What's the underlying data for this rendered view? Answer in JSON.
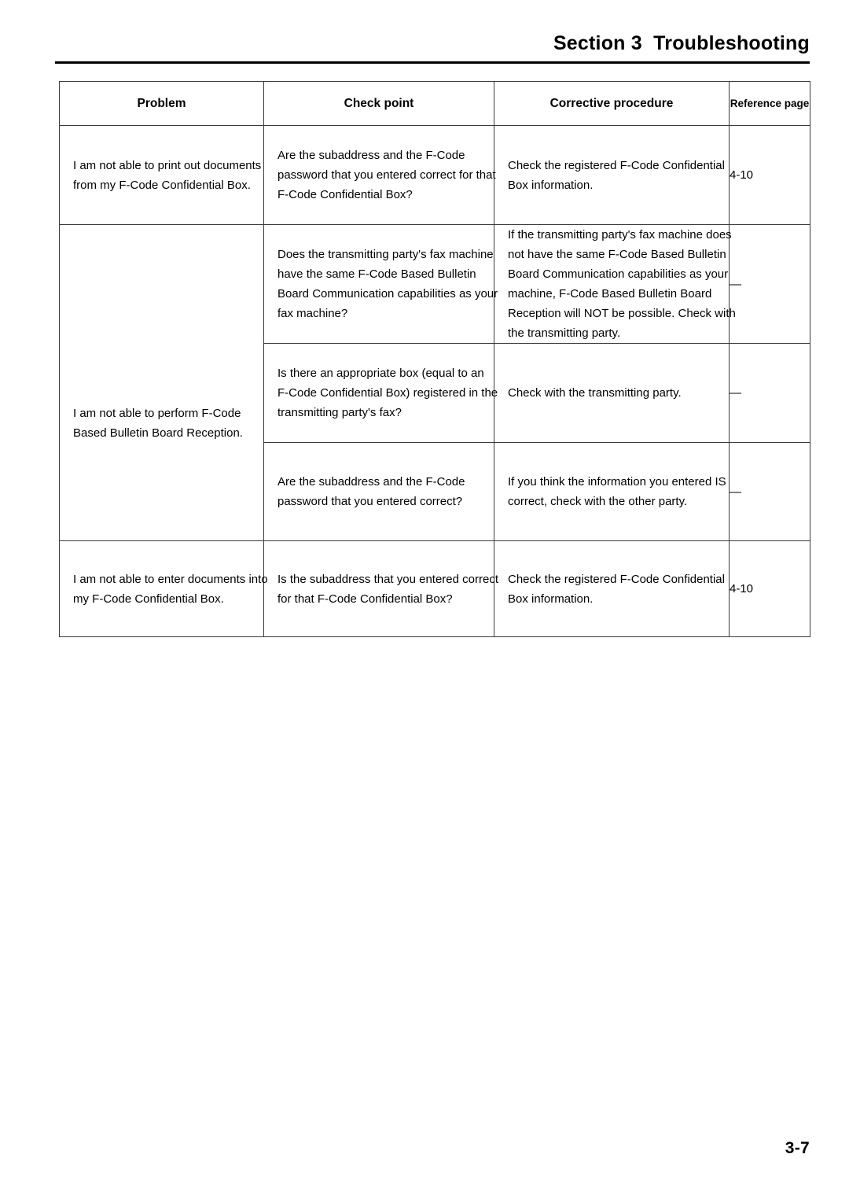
{
  "header": {
    "section_title": "Section 3  Troubleshooting"
  },
  "table": {
    "columns": [
      {
        "id": "problem",
        "label": "Problem"
      },
      {
        "id": "check_point",
        "label": "Check point"
      },
      {
        "id": "corrective_procedure",
        "label": "Corrective procedure"
      },
      {
        "id": "reference_page",
        "label": "Reference page"
      }
    ],
    "rows": [
      {
        "problem": [
          "I am not able to print out documents",
          "from my F-Code Confidential Box."
        ],
        "check_point": [
          "Are the subaddress and the F-Code",
          "password that you entered correct for that",
          "F-Code Confidential Box?"
        ],
        "corrective_procedure": [
          "Check the registered F-Code Confidential",
          "Box information."
        ],
        "reference_page": "4-10"
      },
      {
        "problem": [
          "I am not able to perform F-Code",
          "Based Bulletin Board Reception."
        ],
        "check_point": [
          "Does the transmitting party's fax machine",
          "have the same F-Code Based Bulletin",
          "Board Communication capabilities as your",
          "fax machine?"
        ],
        "corrective_procedure": [
          "If the transmitting party's fax machine does",
          "not have the same F-Code Based Bulletin",
          "Board Communication capabilities as your",
          "machine, F-Code Based Bulletin Board",
          "Reception will NOT be possible. Check with",
          "the transmitting party."
        ],
        "reference_page": "—"
      },
      {
        "problem": [],
        "check_point": [
          "Is there an appropriate box (equal to an",
          "F-Code Confidential Box) registered in the",
          "transmitting party's fax?"
        ],
        "corrective_procedure": [
          "Check with the transmitting party."
        ],
        "reference_page": "—"
      },
      {
        "problem": [],
        "check_point": [
          "Are the subaddress and the F-Code",
          "password that you entered correct?"
        ],
        "corrective_procedure": [
          "If you think the information you entered IS",
          "correct, check with the other party."
        ],
        "reference_page": "—"
      },
      {
        "problem": [
          "I am not able to enter documents into",
          "my F-Code Confidential Box."
        ],
        "check_point": [
          "Is the subaddress that you entered correct",
          "for that F-Code Confidential Box?"
        ],
        "corrective_procedure": [
          "Check the registered F-Code Confidential",
          "Box information."
        ],
        "reference_page": "4-10"
      }
    ]
  },
  "footer": {
    "page_number": "3-7"
  }
}
